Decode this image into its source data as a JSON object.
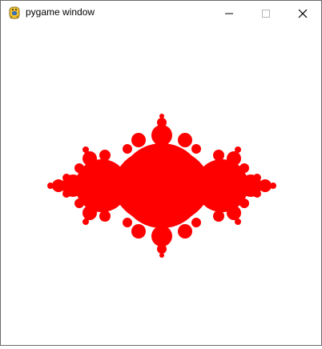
{
  "window": {
    "title": "pygame window",
    "icon": "pygame-snake-icon",
    "controls": [
      "minimize-icon",
      "maximize-icon",
      "close-icon"
    ]
  },
  "canvas": {
    "background": "#ffffff",
    "fractal_color": "#ff0000",
    "content": "julia-set-fractal"
  }
}
